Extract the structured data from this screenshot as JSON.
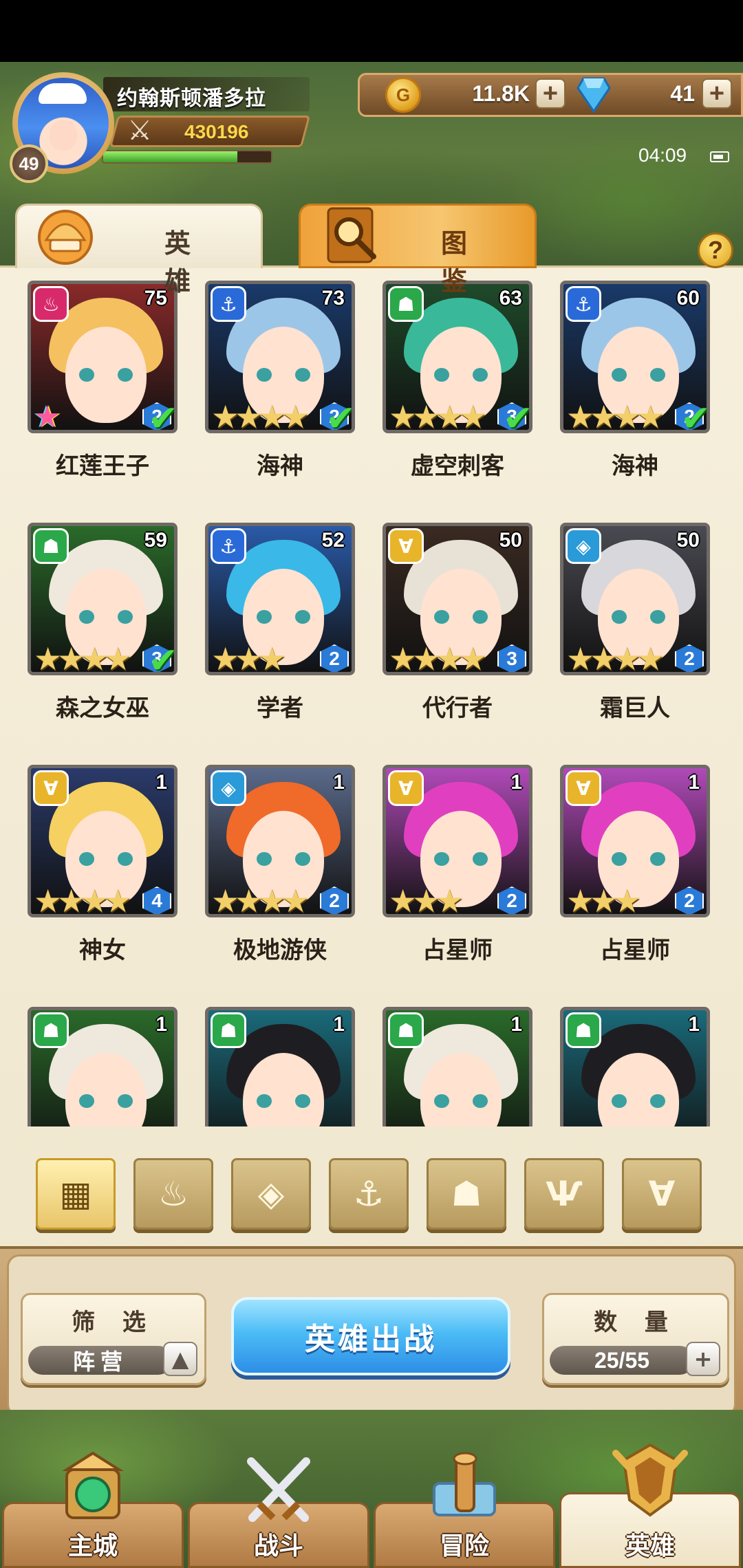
{
  "player": {
    "name": "约翰斯顿潘多拉",
    "level": "49",
    "power": "430196",
    "xp_fraction": 0.8
  },
  "resources": {
    "gold": "11.8K",
    "gems": "41"
  },
  "status": {
    "time": "04:09"
  },
  "tabs": [
    {
      "label": "英 雄",
      "icon": "hero-helmet-icon"
    },
    {
      "label": "图 鉴",
      "icon": "magnifier-icon"
    }
  ],
  "help_label": "?",
  "heroes": [
    {
      "name": "红莲王子",
      "level": "75",
      "rank": "2",
      "stars": 0,
      "faction": "flame",
      "checked": true,
      "rainbow": true,
      "hair": "#f5c060",
      "bg": "#8a2a2a"
    },
    {
      "name": "海神",
      "level": "73",
      "rank": "2",
      "stars": 4,
      "faction": "anchor",
      "checked": true,
      "rainbow": false,
      "hair": "#9cc6e8",
      "bg": "#1a3a6a"
    },
    {
      "name": "虚空刺客",
      "level": "63",
      "rank": "3",
      "stars": 4,
      "faction": "beast",
      "checked": true,
      "rainbow": false,
      "hair": "#3ab89a",
      "bg": "#1f4a2a"
    },
    {
      "name": "海神",
      "level": "60",
      "rank": "2",
      "stars": 4,
      "faction": "anchor",
      "checked": true,
      "rainbow": false,
      "hair": "#9cc6e8",
      "bg": "#1a3a6a"
    },
    {
      "name": "森之女巫",
      "level": "59",
      "rank": "3",
      "stars": 4,
      "faction": "beast",
      "checked": true,
      "rainbow": false,
      "hair": "#efe8dc",
      "bg": "#2a6a2a"
    },
    {
      "name": "学者",
      "level": "52",
      "rank": "2",
      "stars": 3,
      "faction": "anchor",
      "checked": false,
      "rainbow": false,
      "hair": "#3ab8e8",
      "bg": "#2a5aa8"
    },
    {
      "name": "代行者",
      "level": "50",
      "rank": "3",
      "stars": 4,
      "faction": "demon",
      "checked": false,
      "rainbow": false,
      "hair": "#e8e2d6",
      "bg": "#3a2a22"
    },
    {
      "name": "霜巨人",
      "level": "50",
      "rank": "2",
      "stars": 4,
      "faction": "shield",
      "checked": false,
      "rainbow": false,
      "hair": "#d8d8dc",
      "bg": "#4a4a52"
    },
    {
      "name": "神女",
      "level": "1",
      "rank": "4",
      "stars": 4,
      "faction": "demon",
      "checked": false,
      "rainbow": false,
      "hair": "#f6d060",
      "bg": "#2a3a6a"
    },
    {
      "name": "极地游侠",
      "level": "1",
      "rank": "2",
      "stars": 4,
      "faction": "shield",
      "checked": false,
      "rainbow": false,
      "hair": "#f06a2a",
      "bg": "#5a6a8a"
    },
    {
      "name": "占星师",
      "level": "1",
      "rank": "2",
      "stars": 3,
      "faction": "demon",
      "checked": false,
      "rainbow": false,
      "hair": "#e040c0",
      "bg": "#b04ab8"
    },
    {
      "name": "占星师",
      "level": "1",
      "rank": "2",
      "stars": 3,
      "faction": "demon",
      "checked": false,
      "rainbow": false,
      "hair": "#e040c0",
      "bg": "#b04ab8"
    },
    {
      "name": "",
      "level": "1",
      "rank": "",
      "stars": 0,
      "faction": "beast",
      "checked": false,
      "rainbow": false,
      "hair": "#efe8dc",
      "bg": "#2a6a2a"
    },
    {
      "name": "",
      "level": "1",
      "rank": "",
      "stars": 0,
      "faction": "beast",
      "checked": false,
      "rainbow": false,
      "hair": "#1e1e22",
      "bg": "#1a6a7a"
    },
    {
      "name": "",
      "level": "1",
      "rank": "",
      "stars": 0,
      "faction": "beast",
      "checked": false,
      "rainbow": false,
      "hair": "#efe8dc",
      "bg": "#2a6a2a"
    },
    {
      "name": "",
      "level": "1",
      "rank": "",
      "stars": 0,
      "faction": "beast",
      "checked": false,
      "rainbow": false,
      "hair": "#1e1e22",
      "bg": "#1a6a7a"
    }
  ],
  "faction_colors": {
    "flame": "#d82a6a",
    "anchor": "#2a6ad8",
    "beast": "#2aa84a",
    "demon": "#e8b42a",
    "shield": "#2a9ad8"
  },
  "faction_glyphs": {
    "flame": "♨",
    "anchor": "⚓",
    "beast": "☗",
    "demon": "∀",
    "shield": "◈"
  },
  "filters": [
    {
      "icon": "all-grid-icon",
      "glyph": "▦",
      "active": true
    },
    {
      "icon": "flame-faction-icon",
      "glyph": "♨",
      "active": false
    },
    {
      "icon": "shield-faction-icon",
      "glyph": "◈",
      "active": false
    },
    {
      "icon": "anchor-faction-icon",
      "glyph": "⚓",
      "active": false
    },
    {
      "icon": "beast-faction-icon",
      "glyph": "☗",
      "active": false
    },
    {
      "icon": "fox-faction-icon",
      "glyph": "Ѱ",
      "active": false
    },
    {
      "icon": "demon-faction-icon",
      "glyph": "∀",
      "active": false
    }
  ],
  "filter_box": {
    "title": "筛 选",
    "value": "阵营"
  },
  "deploy_label": "英雄出战",
  "count_box": {
    "title": "数 量",
    "value": "25/55"
  },
  "nav": [
    {
      "label": "主城",
      "icon": "main-city-icon",
      "active": false
    },
    {
      "label": "战斗",
      "icon": "crossed-swords-icon",
      "active": false
    },
    {
      "label": "冒险",
      "icon": "map-scroll-icon",
      "active": false
    },
    {
      "label": "英雄",
      "icon": "hero-crest-icon",
      "active": true
    }
  ]
}
